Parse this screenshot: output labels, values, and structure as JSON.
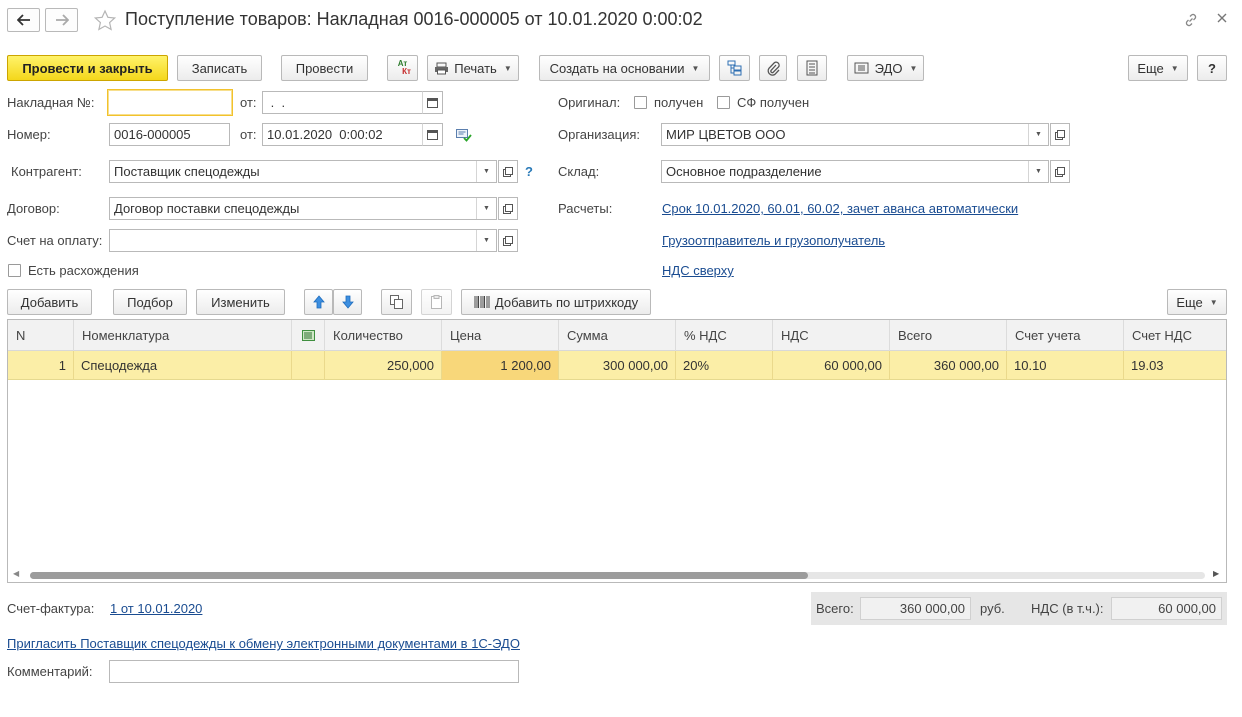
{
  "window": {
    "title": "Поступление товаров: Накладная 0016-000005 от 10.01.2020 0:00:02"
  },
  "toolbar": {
    "post_close": "Провести и закрыть",
    "save": "Записать",
    "post": "Провести",
    "dtkt_top": "Ат",
    "dtkt_bottom": "Кт",
    "print": "Печать",
    "create_based": "Создать на основании",
    "edo": "ЭДО",
    "more": "Еще",
    "help": "?"
  },
  "header": {
    "invoice_no_label": "Накладная №:",
    "invoice_no_value": "",
    "from_label": "от:",
    "invoice_date_value": " .  .",
    "number_label": "Номер:",
    "number_value": "0016-000005",
    "number_date_value": "10.01.2020  0:00:02",
    "original_label": "Оригинал:",
    "received_label": "получен",
    "sf_received_label": "СФ получен",
    "org_label": "Организация:",
    "org_value": "МИР ЦВЕТОВ ООО",
    "counterparty_label": "Контрагент:",
    "counterparty_value": "Поставщик спецодежды",
    "help_q": "?",
    "warehouse_label": "Склад:",
    "warehouse_value": "Основное подразделение",
    "contract_label": "Договор:",
    "contract_value": "Договор поставки спецодежды",
    "settlements_label": "Расчеты:",
    "settlements_link": "Срок 10.01.2020, 60.01, 60.02, зачет аванса автоматически",
    "payment_invoice_label": "Счет на оплату:",
    "payment_invoice_value": "",
    "shipper_link": "Грузоотправитель и грузополучатель",
    "discrepancy_label": "Есть расхождения",
    "vat_link": "НДС сверху"
  },
  "table_toolbar": {
    "add": "Добавить",
    "pick": "Подбор",
    "change": "Изменить",
    "barcode": "Добавить по штрихкоду",
    "more": "Еще"
  },
  "table": {
    "columns": [
      "N",
      "Номенклатура",
      "",
      "Количество",
      "Цена",
      "Сумма",
      "% НДС",
      "НДС",
      "Всего",
      "Счет учета",
      "Счет НДС"
    ],
    "rows": [
      [
        "1",
        "Спецодежда",
        "",
        "250,000",
        "1 200,00",
        "300 000,00",
        "20%",
        "60 000,00",
        "360 000,00",
        "10.10",
        "19.03"
      ]
    ]
  },
  "footer": {
    "sf_label": "Счет-фактура:",
    "sf_link": "1 от 10.01.2020",
    "total_label": "Всего:",
    "total_value": "360 000,00",
    "currency": "руб.",
    "vat_label": "НДС (в т.ч.):",
    "vat_value": "60 000,00",
    "invite_link": "Пригласить Поставщик спецодежды к обмену электронными документами в 1С-ЭДО",
    "comment_label": "Комментарий:",
    "comment_value": ""
  },
  "colors": {
    "primary_button": "#f4d71b",
    "selected_row": "#fbeea7",
    "link": "#1a4c91",
    "focus_border": "#f2c22c"
  }
}
